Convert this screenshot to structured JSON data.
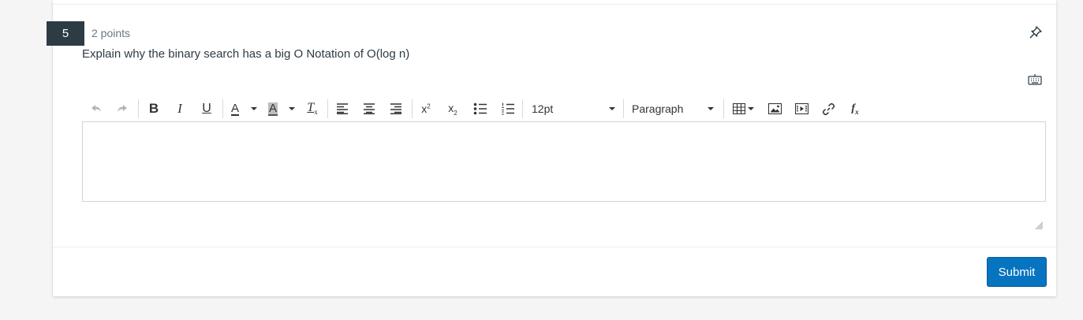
{
  "question": {
    "number": "5",
    "points": "2 points",
    "text": "Explain why the binary search has a big O Notation of O(log n)"
  },
  "toolbar": {
    "font_size": "12pt",
    "block_format": "Paragraph",
    "superscript_base": "x",
    "superscript_mark": "2",
    "subscript_base": "x",
    "subscript_mark": "2",
    "bold_glyph": "B",
    "italic_glyph": "I",
    "underline_glyph": "U",
    "text_color_glyph": "A",
    "bg_color_glyph": "A",
    "clear_format_glyph": "T",
    "clear_format_mark": "x",
    "equation_glyph": "f",
    "equation_mark": "x"
  },
  "editor": {
    "value": ""
  },
  "actions": {
    "submit_label": "Submit"
  },
  "colors": {
    "accent": "#0774c0",
    "number_badge": "#2d3b45",
    "page_bg": "#f5f5f5"
  }
}
